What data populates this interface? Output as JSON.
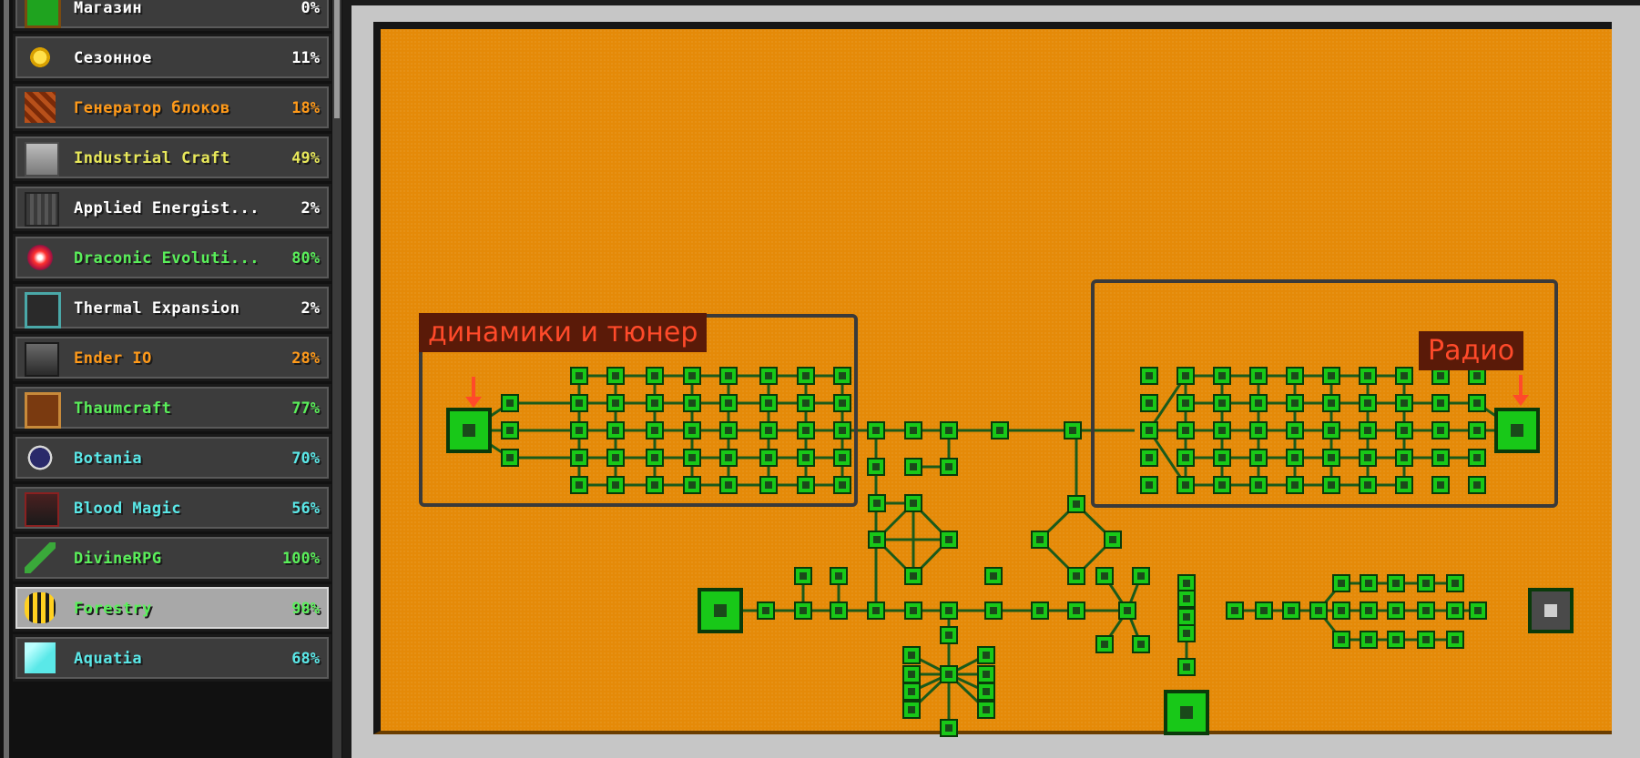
{
  "sidebar": {
    "items": [
      {
        "label": "Магазин",
        "percent": "0%",
        "color": "#ffffff",
        "icon": "shop-icon"
      },
      {
        "label": "Сезонное",
        "percent": "11%",
        "color": "#ffffff",
        "icon": "sun-icon"
      },
      {
        "label": "Генератор блоков",
        "percent": "18%",
        "color": "#ff9a1a",
        "icon": "block-generator-icon"
      },
      {
        "label": "Industrial Craft",
        "percent": "49%",
        "color": "#e8e85a",
        "icon": "machine-block-icon"
      },
      {
        "label": "Applied Energist...",
        "percent": "2%",
        "color": "#ffffff",
        "icon": "me-block-icon"
      },
      {
        "label": "Draconic Evoluti...",
        "percent": "80%",
        "color": "#5aef5a",
        "icon": "draconic-core-icon"
      },
      {
        "label": "Thermal Expansion",
        "percent": "2%",
        "color": "#ffffff",
        "icon": "thermal-machine-icon"
      },
      {
        "label": "Ender IO",
        "percent": "28%",
        "color": "#ff9a1a",
        "icon": "ender-machine-icon"
      },
      {
        "label": "Thaumcraft",
        "percent": "77%",
        "color": "#5aef5a",
        "icon": "thaumonomicon-icon"
      },
      {
        "label": "Botania",
        "percent": "70%",
        "color": "#5ae8e8",
        "icon": "lexicon-icon"
      },
      {
        "label": "Blood Magic",
        "percent": "56%",
        "color": "#5ae8e8",
        "icon": "blood-altar-icon"
      },
      {
        "label": "DivineRPG",
        "percent": "100%",
        "color": "#5aef5a",
        "icon": "divine-sword-icon"
      },
      {
        "label": "Forestry",
        "percent": "98%",
        "color": "#5aef5a",
        "icon": "bee-icon",
        "selected": true
      },
      {
        "label": "Aquatia",
        "percent": "68%",
        "color": "#5ae8e8",
        "icon": "crystal-icon"
      }
    ]
  },
  "board": {
    "label_left": "динамики и тюнер",
    "label_right": "Радио",
    "arrow_color": "#ff4a2a",
    "node_color": "#18c818",
    "line_color": "#1a5a1a"
  }
}
